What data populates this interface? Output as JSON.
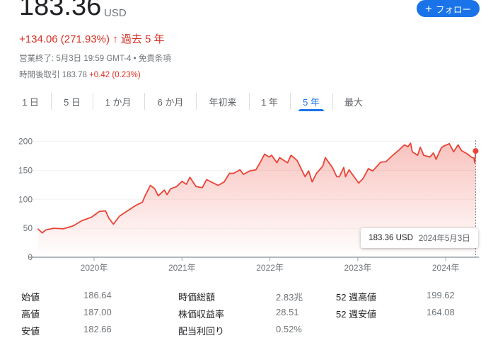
{
  "quote": {
    "price": "183.36",
    "currency": "USD",
    "change": "+134.06 (271.93%)",
    "change_arrow_icon": "arrow-up-icon",
    "period": "過去 5 年",
    "status": "営業終了: 5月3日 19:59 GMT-4 • 免責条項",
    "after_hours_label": "時間後取引",
    "after_hours_price": "183.78",
    "after_hours_change": "+0.42 (0.23%)"
  },
  "follow_button": {
    "icon": "plus-icon",
    "label": "フォロー"
  },
  "colors": {
    "accent": "#1a73e8",
    "line": "#ea4335",
    "negative_positive_text": "#d93025"
  },
  "tabs": [
    {
      "label": "1 日",
      "active": false
    },
    {
      "label": "5 日",
      "active": false
    },
    {
      "label": "1 か月",
      "active": false
    },
    {
      "label": "6 か月",
      "active": false
    },
    {
      "label": "年初来",
      "active": false
    },
    {
      "label": "1 年",
      "active": false
    },
    {
      "label": "5 年",
      "active": true
    },
    {
      "label": "最大",
      "active": false
    }
  ],
  "chart_data": {
    "type": "area",
    "ylim": [
      0,
      200
    ],
    "yticks": [
      "0",
      "50",
      "100",
      "150",
      "200"
    ],
    "xticks": [
      "2020年",
      "2021年",
      "2022年",
      "2023年",
      "2024年"
    ],
    "grid": true,
    "x": [
      2019.36,
      2019.41,
      2019.45,
      2019.54,
      2019.65,
      2019.76,
      2019.86,
      2019.97,
      2020.06,
      2020.13,
      2020.17,
      2020.22,
      2020.29,
      2020.37,
      2020.47,
      2020.55,
      2020.58,
      2020.64,
      2020.69,
      2020.73,
      2020.8,
      2020.83,
      2020.87,
      2020.94,
      2021.0,
      2021.05,
      2021.09,
      2021.16,
      2021.23,
      2021.28,
      2021.41,
      2021.48,
      2021.54,
      2021.59,
      2021.66,
      2021.7,
      2021.77,
      2021.84,
      2021.88,
      2021.94,
      2021.99,
      2022.02,
      2022.08,
      2022.11,
      2022.2,
      2022.24,
      2022.31,
      2022.4,
      2022.44,
      2022.48,
      2022.53,
      2022.6,
      2022.63,
      2022.71,
      2022.76,
      2022.79,
      2022.84,
      2022.86,
      2022.9,
      2023.01,
      2023.06,
      2023.12,
      2023.17,
      2023.26,
      2023.32,
      2023.39,
      2023.46,
      2023.53,
      2023.57,
      2023.6,
      2023.62,
      2023.68,
      2023.71,
      2023.75,
      2023.82,
      2023.86,
      2023.89,
      2023.95,
      2023.98,
      2024.04,
      2024.09,
      2024.14,
      2024.18,
      2024.25,
      2024.29,
      2024.32,
      2024.33,
      2024.34
    ],
    "values": [
      49,
      42,
      47,
      50,
      49,
      54,
      63,
      69,
      79,
      80,
      67,
      57,
      71,
      79,
      89,
      95,
      106,
      124,
      118,
      106,
      116,
      108,
      118,
      122,
      131,
      126,
      138,
      122,
      120,
      134,
      124,
      130,
      145,
      145,
      151,
      143,
      149,
      151,
      161,
      178,
      173,
      176,
      163,
      172,
      163,
      176,
      167,
      139,
      149,
      130,
      145,
      157,
      172,
      155,
      139,
      139,
      155,
      139,
      151,
      128,
      136,
      153,
      149,
      164,
      165,
      175,
      184,
      194,
      191,
      197,
      182,
      176,
      190,
      176,
      173,
      180,
      169,
      189,
      192,
      196,
      182,
      194,
      184,
      178,
      173,
      171,
      163,
      183.36
    ],
    "tooltip": {
      "value": "183.36 USD",
      "date": "2024年5月3日"
    }
  },
  "stats": [
    {
      "label": "始値",
      "value": "186.64"
    },
    {
      "label": "高値",
      "value": "187.00"
    },
    {
      "label": "安値",
      "value": "182.66"
    },
    {
      "label": "時価総額",
      "value": "2.83兆"
    },
    {
      "label": "株価収益率",
      "value": "28.51"
    },
    {
      "label": "配当利回り",
      "value": "0.52%"
    },
    {
      "label": "52 週高値",
      "value": "199.62"
    },
    {
      "label": "52 週安値",
      "value": "164.08"
    }
  ]
}
